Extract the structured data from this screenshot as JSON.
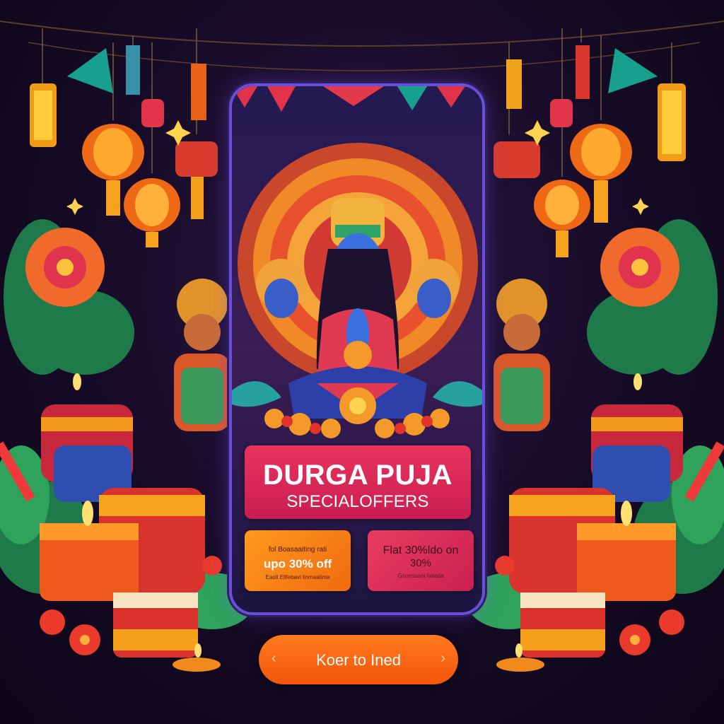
{
  "promo": {
    "title": "DURGA PUJA",
    "subtitle": "SPECIALOFFERS",
    "offers": [
      {
        "small": "fol Boasaaiting rati",
        "big": "upo 30% off",
        "tiny": "Eaoll Ellfebavi linmaatinia"
      },
      {
        "big": "Flat 30%ldo on",
        "big2": "30%",
        "tiny": "Gnorrssani fanatia"
      }
    ]
  },
  "cta": {
    "label": "Koer to Ined",
    "left_arrow": "‹",
    "right_arrow": "›"
  },
  "colors": {
    "accent": "#f2560a",
    "banner": "#e8345e",
    "phone_border": "#6b4fd8"
  }
}
